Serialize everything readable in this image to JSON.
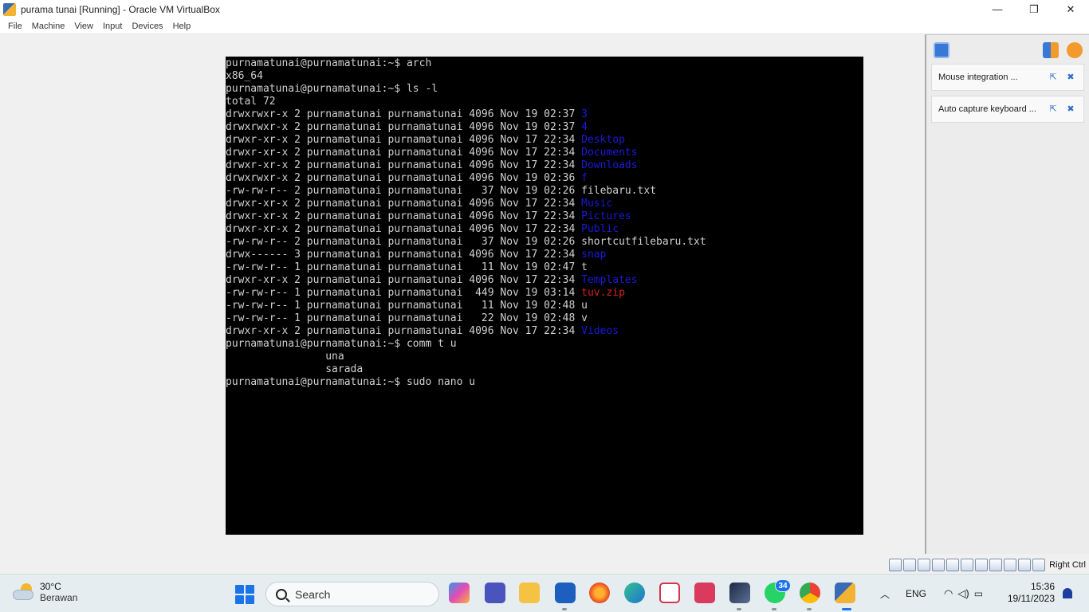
{
  "window": {
    "title": "purama tunai [Running] - Oracle VM VirtualBox",
    "minimize": "—",
    "restore": "❐",
    "close": "✕"
  },
  "menu": [
    "File",
    "Machine",
    "View",
    "Input",
    "Devices",
    "Help"
  ],
  "terminal": {
    "lines": [
      [
        {
          "t": "purnamatunai@purnamatunai:~$ arch"
        }
      ],
      [
        {
          "t": "x86_64"
        }
      ],
      [
        {
          "t": "purnamatunai@purnamatunai:~$ ls -l"
        }
      ],
      [
        {
          "t": "total 72"
        }
      ],
      [
        {
          "t": "drwxrwxr-x 2 purnamatunai purnamatunai 4096 Nov 19 02:37 "
        },
        {
          "t": "3",
          "c": "dir"
        }
      ],
      [
        {
          "t": "drwxrwxr-x 2 purnamatunai purnamatunai 4096 Nov 19 02:37 "
        },
        {
          "t": "4",
          "c": "dir"
        }
      ],
      [
        {
          "t": "drwxr-xr-x 2 purnamatunai purnamatunai 4096 Nov 17 22:34 "
        },
        {
          "t": "Desktop",
          "c": "dir"
        }
      ],
      [
        {
          "t": "drwxr-xr-x 2 purnamatunai purnamatunai 4096 Nov 17 22:34 "
        },
        {
          "t": "Documents",
          "c": "dir"
        }
      ],
      [
        {
          "t": "drwxr-xr-x 2 purnamatunai purnamatunai 4096 Nov 17 22:34 "
        },
        {
          "t": "Downloads",
          "c": "dir"
        }
      ],
      [
        {
          "t": "drwxrwxr-x 2 purnamatunai purnamatunai 4096 Nov 19 02:36 "
        },
        {
          "t": "f",
          "c": "dir"
        }
      ],
      [
        {
          "t": "-rw-rw-r-- 2 purnamatunai purnamatunai   37 Nov 19 02:26 filebaru.txt"
        }
      ],
      [
        {
          "t": "drwxr-xr-x 2 purnamatunai purnamatunai 4096 Nov 17 22:34 "
        },
        {
          "t": "Music",
          "c": "dir"
        }
      ],
      [
        {
          "t": "drwxr-xr-x 2 purnamatunai purnamatunai 4096 Nov 17 22:34 "
        },
        {
          "t": "Pictures",
          "c": "dir"
        }
      ],
      [
        {
          "t": "drwxr-xr-x 2 purnamatunai purnamatunai 4096 Nov 17 22:34 "
        },
        {
          "t": "Public",
          "c": "dir"
        }
      ],
      [
        {
          "t": "-rw-rw-r-- 2 purnamatunai purnamatunai   37 Nov 19 02:26 shortcutfilebaru.txt"
        }
      ],
      [
        {
          "t": "drwx------ 3 purnamatunai purnamatunai 4096 Nov 17 22:34 "
        },
        {
          "t": "snap",
          "c": "dir"
        }
      ],
      [
        {
          "t": "-rw-rw-r-- 1 purnamatunai purnamatunai   11 Nov 19 02:47 t"
        }
      ],
      [
        {
          "t": "drwxr-xr-x 2 purnamatunai purnamatunai 4096 Nov 17 22:34 "
        },
        {
          "t": "Templates",
          "c": "dir"
        }
      ],
      [
        {
          "t": "-rw-rw-r-- 1 purnamatunai purnamatunai  449 Nov 19 03:14 "
        },
        {
          "t": "tuv.zip",
          "c": "zip"
        }
      ],
      [
        {
          "t": "-rw-rw-r-- 1 purnamatunai purnamatunai   11 Nov 19 02:48 u"
        }
      ],
      [
        {
          "t": "-rw-rw-r-- 1 purnamatunai purnamatunai   22 Nov 19 02:48 v"
        }
      ],
      [
        {
          "t": "drwxr-xr-x 2 purnamatunai purnamatunai 4096 Nov 17 22:34 "
        },
        {
          "t": "Videos",
          "c": "dir"
        }
      ],
      [
        {
          "t": "purnamatunai@purnamatunai:~$ comm t u"
        }
      ],
      [
        {
          "t": "                una"
        }
      ],
      [
        {
          "t": "                sarada"
        }
      ],
      [
        {
          "t": "purnamatunai@purnamatunai:~$ sudo nano u"
        }
      ]
    ]
  },
  "notifications": [
    {
      "label": "Mouse integration ..."
    },
    {
      "label": "Auto capture keyboard ..."
    }
  ],
  "statusbar": {
    "host_key": "Right Ctrl"
  },
  "taskbar": {
    "weather_temp": "30°C",
    "weather_desc": "Berawan",
    "search_placeholder": "Search",
    "whatsapp_badge": "34",
    "lang": "ENG",
    "time": "15:36",
    "date": "19/11/2023"
  },
  "colors": {
    "terminal_bg": "#000000",
    "terminal_fg": "#d0d0d0",
    "dir_color": "#1a1ad8",
    "zip_color": "#d82020",
    "taskbar_bg": "#e5edf0"
  }
}
